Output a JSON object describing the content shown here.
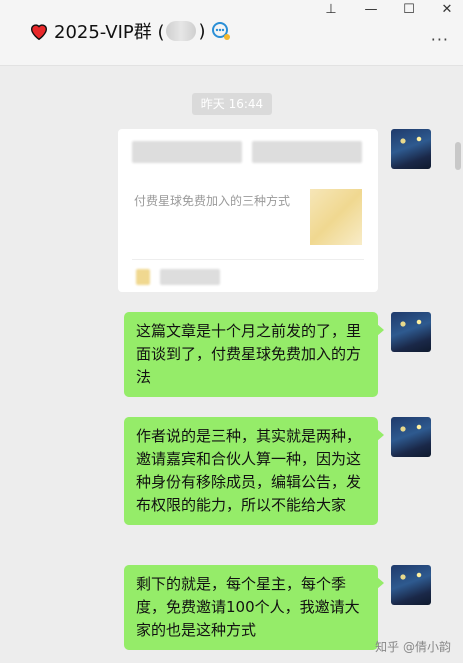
{
  "header": {
    "title_prefix": "2025-VIP群 (",
    "title_suffix": ")",
    "more_label": "···"
  },
  "window_controls": [
    "⊥",
    "—",
    "☐",
    "✕"
  ],
  "chat": {
    "timestamp": "昨天 16:44",
    "shared_card": {
      "title": "付费星球免费加入的三种方式"
    },
    "messages": [
      {
        "text": "这篇文章是十个月之前发的了，里面谈到了，付费星球免费加入的方法"
      },
      {
        "text": "作者说的是三种，其实就是两种，邀请嘉宾和合伙人算一种，因为这种身份有移除成员，编辑公告，发布权限的能力，所以不能给大家"
      },
      {
        "text": "剩下的就是，每个星主，每个季度，免费邀请100个人，我邀请大家的也是这种方式"
      }
    ]
  },
  "watermark": "知乎 @倩小韵",
  "colors": {
    "bubble": "#95ec69",
    "background": "#ededed"
  }
}
